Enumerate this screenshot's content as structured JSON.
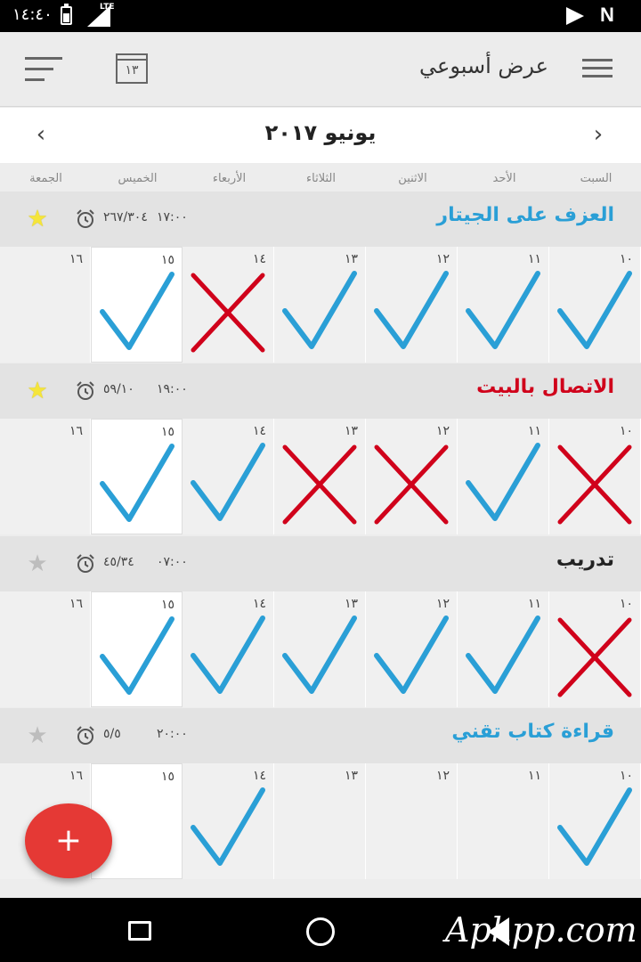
{
  "status_bar": {
    "time": "١٤:٤٠",
    "network": "LTE",
    "icons": [
      "battery-icon",
      "signal-icon",
      "play-store-icon",
      "notification-n-icon"
    ]
  },
  "app_bar": {
    "title": "عرض أسبوعي",
    "calendar_day": "١٣",
    "icons": [
      "sort-icon",
      "calendar-icon",
      "menu-icon"
    ]
  },
  "month_header": {
    "title": "يونيو ٢٠١٧",
    "prev_label": "‹",
    "next_label": "›"
  },
  "day_names": [
    "السبت",
    "الأحد",
    "الاثنين",
    "الثلاثاء",
    "الأربعاء",
    "الخميس",
    "الجمعة"
  ],
  "day_numbers": [
    "١٠",
    "١١",
    "١٢",
    "١٣",
    "١٤",
    "١٥",
    "١٦"
  ],
  "today_index": 5,
  "colors": {
    "check": "#2a9fd6",
    "cross": "#d0021b",
    "star_active": "#f5e53a",
    "star_inactive": "#bdbdbd",
    "habit_blue": "#2a9fd6",
    "habit_red": "#d0021b",
    "habit_dark": "#222222",
    "fab": "#e53935"
  },
  "habits": [
    {
      "name": "العزف على الجيتار",
      "name_color": "#2a9fd6",
      "time": "١٧:٠٠",
      "count": "٢٦٧/٣٠٤",
      "starred": true,
      "marks": [
        "check",
        "check",
        "check",
        "check",
        "cross",
        "check",
        "none"
      ]
    },
    {
      "name": "الاتصال بالبيت",
      "name_color": "#d0021b",
      "time": "١٩:٠٠",
      "count": "٥٩/١٠",
      "starred": true,
      "marks": [
        "cross",
        "check",
        "cross",
        "cross",
        "check",
        "check",
        "none"
      ]
    },
    {
      "name": "تدريب",
      "name_color": "#222222",
      "time": "٠٧:٠٠",
      "count": "٤٥/٣٤",
      "starred": false,
      "marks": [
        "cross",
        "check",
        "check",
        "check",
        "check",
        "check",
        "none"
      ]
    },
    {
      "name": "قراءة كتاب تقني",
      "name_color": "#2a9fd6",
      "time": "٢٠:٠٠",
      "count": "٥/٥",
      "starred": false,
      "marks": [
        "check",
        "none",
        "none",
        "none",
        "check",
        "none",
        "none"
      ]
    }
  ],
  "fab": {
    "label": "+"
  },
  "watermark": "Apkpp.com"
}
